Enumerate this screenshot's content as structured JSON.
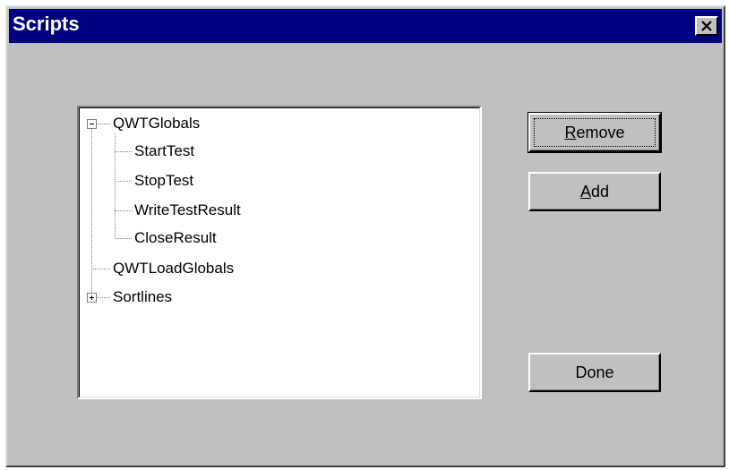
{
  "window": {
    "title": "Scripts",
    "close_label": "✕"
  },
  "tree": {
    "nodes": [
      {
        "label": "QWTGlobals",
        "expanded": true,
        "children": [
          "StartTest",
          "StopTest",
          "WriteTestResult",
          "CloseResult"
        ]
      },
      {
        "label": "QWTLoadGlobals"
      },
      {
        "label": "Sortlines",
        "expanded": false
      }
    ]
  },
  "buttons": {
    "remove": {
      "mnemonic": "R",
      "rest": "emove"
    },
    "add": {
      "mnemonic": "A",
      "rest": "dd"
    },
    "done": "Done"
  }
}
